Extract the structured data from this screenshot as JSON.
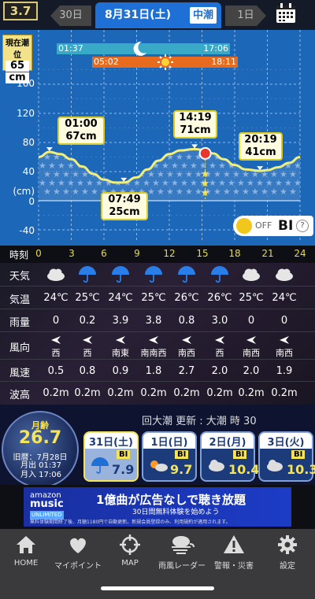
{
  "app": {
    "version_badge": "3.7"
  },
  "header": {
    "prev_label": "30日",
    "date": "8月31日(土)",
    "tide_type": "中潮",
    "next_label": "1日"
  },
  "chart": {
    "current_level_title": "現在潮位",
    "current_level_value": "65",
    "current_level_unit": "cm",
    "moon_rise": "01:37",
    "moon_set": "17:06",
    "sun_rise": "05:02",
    "sun_set": "18:11",
    "y_labels": [
      "160",
      "120",
      "80",
      "40",
      "(cm)",
      "0",
      "-40"
    ],
    "tide_labels": [
      {
        "time": "01:00",
        "level": "67cm"
      },
      {
        "time": "07:49",
        "level": "25cm"
      },
      {
        "time": "14:19",
        "level": "71cm"
      },
      {
        "time": "20:19",
        "level": "41cm"
      }
    ],
    "toggle_state": "OFF",
    "toggle_label": "BI",
    "help": "?"
  },
  "chart_data": {
    "type": "line",
    "title": "",
    "xlabel": "時刻",
    "ylabel": "(cm)",
    "xlim": [
      0,
      24
    ],
    "ylim": [
      -40,
      180
    ],
    "x": [
      0,
      1,
      2,
      3,
      4,
      5,
      6,
      7,
      7.82,
      9,
      10,
      11,
      12,
      13,
      14.32,
      15,
      16,
      17,
      18,
      19,
      20.32,
      21,
      22,
      23,
      24
    ],
    "series": [
      {
        "values": [
          60,
          67,
          64,
          57,
          47,
          37,
          29,
          25,
          25,
          32,
          43,
          55,
          64,
          69,
          71,
          70,
          65,
          57,
          49,
          43,
          41,
          42,
          46,
          52,
          60
        ]
      }
    ],
    "current": {
      "x": 15.3,
      "y": 65
    },
    "hour_ticks": [
      "0",
      "3",
      "6",
      "9",
      "12",
      "15",
      "18",
      "21",
      "24"
    ]
  },
  "hours": {
    "label": "時刻",
    "ticks": [
      "0",
      "3",
      "6",
      "9",
      "12",
      "15",
      "18",
      "21",
      "24"
    ]
  },
  "weather": {
    "rows": [
      {
        "label": "天気",
        "key": "weather"
      },
      {
        "label": "気温",
        "key": "temp"
      },
      {
        "label": "雨量",
        "key": "rain"
      },
      {
        "label": "風向",
        "key": "wind_dir"
      },
      {
        "label": "風速",
        "key": "wind_speed"
      },
      {
        "label": "波高",
        "key": "wave"
      }
    ],
    "icons": [
      "cloud-icon",
      "umbrella-icon",
      "umbrella-icon",
      "umbrella-icon",
      "umbrella-icon",
      "umbrella-icon",
      "cloud-icon",
      "cloud-icon"
    ],
    "temp": [
      "24℃",
      "25℃",
      "24℃",
      "25℃",
      "26℃",
      "26℃",
      "25℃",
      "24℃"
    ],
    "rain": [
      "0",
      "0.2",
      "3.9",
      "3.8",
      "0.8",
      "3.0",
      "0",
      "0"
    ],
    "wind_dir": [
      "西",
      "西",
      "南東",
      "南南西",
      "南西",
      "西",
      "南西",
      "南西"
    ],
    "wind_speed": [
      "0.5",
      "0.8",
      "0.9",
      "1.8",
      "2.7",
      "2.0",
      "2.0",
      "1.9"
    ],
    "wave": [
      "0.2m",
      "0.2m",
      "0.2m",
      "0.2m",
      "0.2m",
      "0.2m",
      "0.2m",
      "0.2m"
    ]
  },
  "moon": {
    "title": "月齢",
    "age": "26.7",
    "lunar_date": "旧暦：7月28日",
    "rise": "月出 01:37",
    "set": "月入 17:06"
  },
  "update_text": "回大潮 更新 : 大潮 時 30",
  "forecast_cards": [
    {
      "day": "31日(土)",
      "prefix": "中潮",
      "badge": "BI",
      "score": "7.9",
      "selected": true
    },
    {
      "day": "1日(日)",
      "prefix": "",
      "badge": "BI",
      "score": "9.7",
      "selected": false
    },
    {
      "day": "2日(月)",
      "prefix": "",
      "badge": "BI",
      "score": "10.4",
      "selected": false
    },
    {
      "day": "3日(火)",
      "prefix": "",
      "badge": "BI",
      "score": "10.3",
      "selected": false
    }
  ],
  "ad": {
    "brand_line1": "amazon",
    "brand_line2": "music",
    "brand_line3": "UNLIMITED",
    "headline": "1億曲が広告なしで聴き放題",
    "sub": "30日間無料体験を始めよう",
    "fine": "無料体験期間終了後、月額1180円で自動更新。新規会員登録のみ、利用規約が適用されます。"
  },
  "tabs": [
    {
      "label": "HOME",
      "icon": "home-icon"
    },
    {
      "label": "マイポイント",
      "icon": "heart-icon"
    },
    {
      "label": "MAP",
      "icon": "crosshair-icon"
    },
    {
      "label": "雨風レーダー",
      "icon": "storm-icon"
    },
    {
      "label": "警報・災害",
      "icon": "warning-icon"
    },
    {
      "label": "設定",
      "icon": "gear-icon"
    }
  ],
  "colors": {
    "chart_bg": "#1c67b8",
    "tide_line": "#f2ee7a",
    "accent": "#1e6fd6",
    "highlight": "#f5e35a"
  }
}
